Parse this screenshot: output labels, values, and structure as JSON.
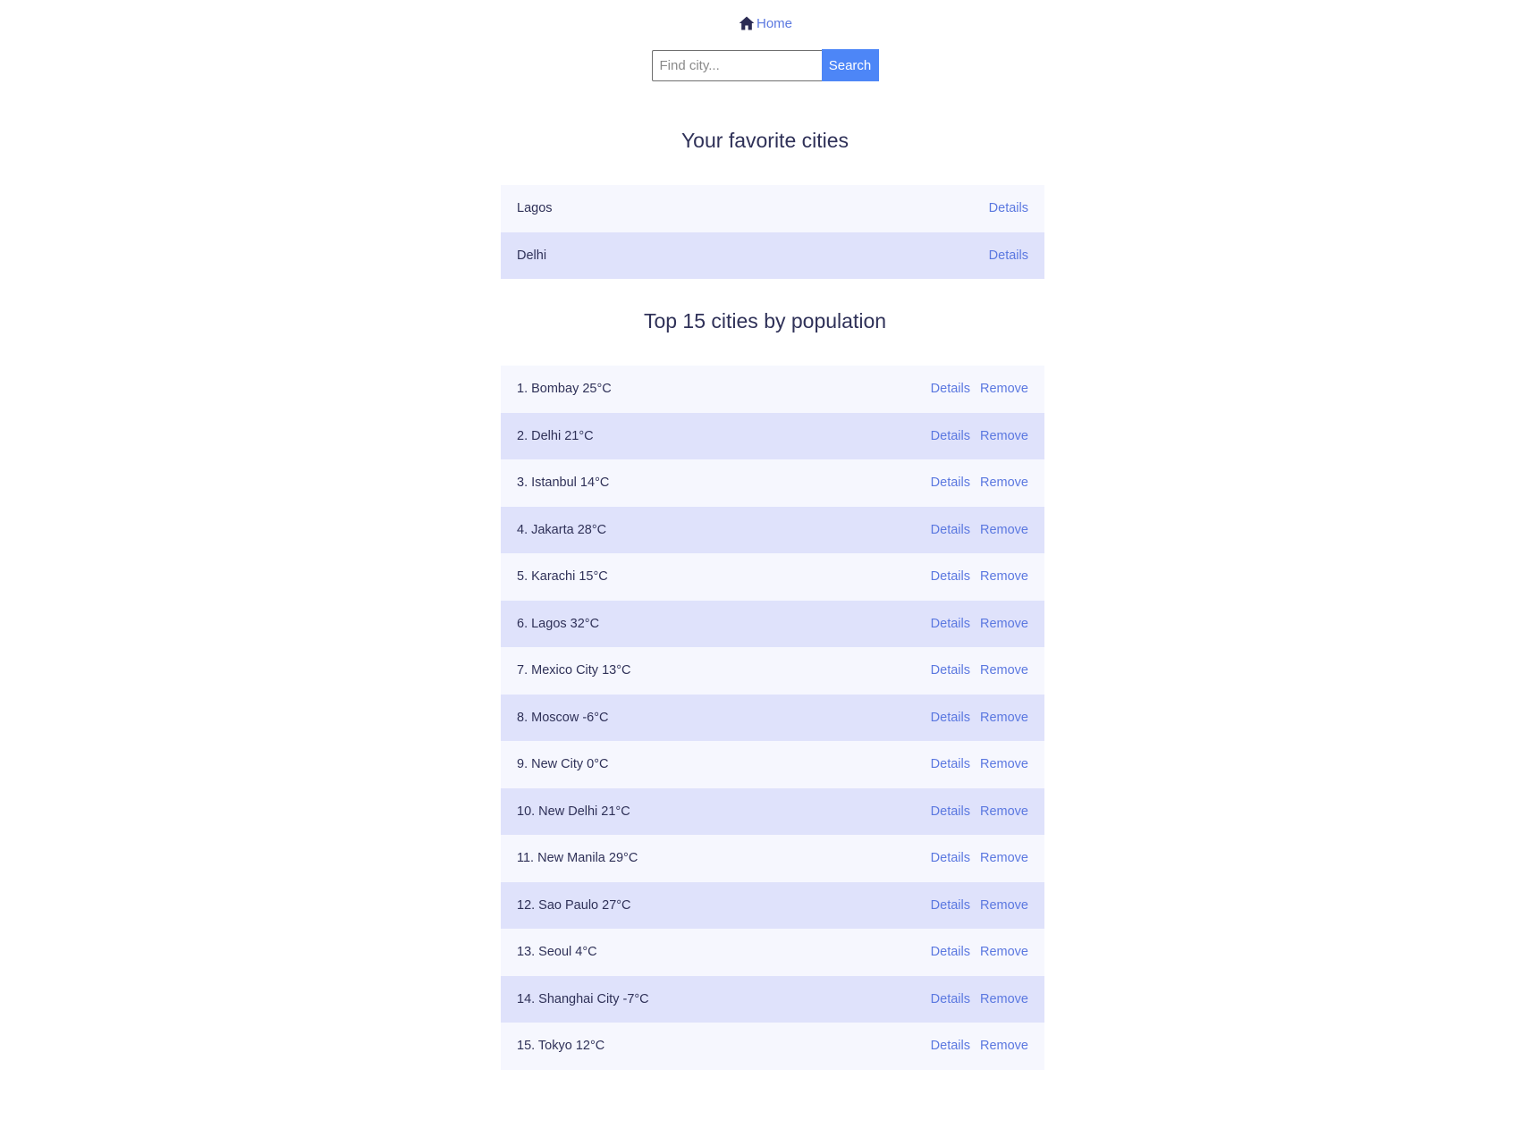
{
  "nav": {
    "home_label": "Home",
    "home_icon": "home-icon"
  },
  "search": {
    "placeholder": "Find city...",
    "value": "",
    "button_label": "Search"
  },
  "favorites": {
    "title": "Your favorite cities",
    "items": [
      {
        "label": "Lagos",
        "details": "Details"
      },
      {
        "label": "Delhi",
        "details": "Details"
      }
    ]
  },
  "top_cities": {
    "title": "Top 15 cities by population",
    "items": [
      {
        "label": "1. Bombay 25°C",
        "details": "Details",
        "remove": "Remove"
      },
      {
        "label": "2. Delhi 21°C",
        "details": "Details",
        "remove": "Remove"
      },
      {
        "label": "3. Istanbul 14°C",
        "details": "Details",
        "remove": "Remove"
      },
      {
        "label": "4. Jakarta 28°C",
        "details": "Details",
        "remove": "Remove"
      },
      {
        "label": "5. Karachi 15°C",
        "details": "Details",
        "remove": "Remove"
      },
      {
        "label": "6. Lagos 32°C",
        "details": "Details",
        "remove": "Remove"
      },
      {
        "label": "7. Mexico City 13°C",
        "details": "Details",
        "remove": "Remove"
      },
      {
        "label": "8. Moscow -6°C",
        "details": "Details",
        "remove": "Remove"
      },
      {
        "label": "9. New City 0°C",
        "details": "Details",
        "remove": "Remove"
      },
      {
        "label": "10. New Delhi 21°C",
        "details": "Details",
        "remove": "Remove"
      },
      {
        "label": "11. New Manila 29°C",
        "details": "Details",
        "remove": "Remove"
      },
      {
        "label": "12. Sao Paulo 27°C",
        "details": "Details",
        "remove": "Remove"
      },
      {
        "label": "13. Seoul 4°C",
        "details": "Details",
        "remove": "Remove"
      },
      {
        "label": "14. Shanghai City -7°C",
        "details": "Details",
        "remove": "Remove"
      },
      {
        "label": "15. Tokyo 12°C",
        "details": "Details",
        "remove": "Remove"
      }
    ]
  },
  "colors": {
    "link": "#5b78e0",
    "button": "#4d86f7",
    "row_light": "#f6f7fe",
    "row_dark": "#dfe2fb",
    "text": "#2f3158"
  }
}
